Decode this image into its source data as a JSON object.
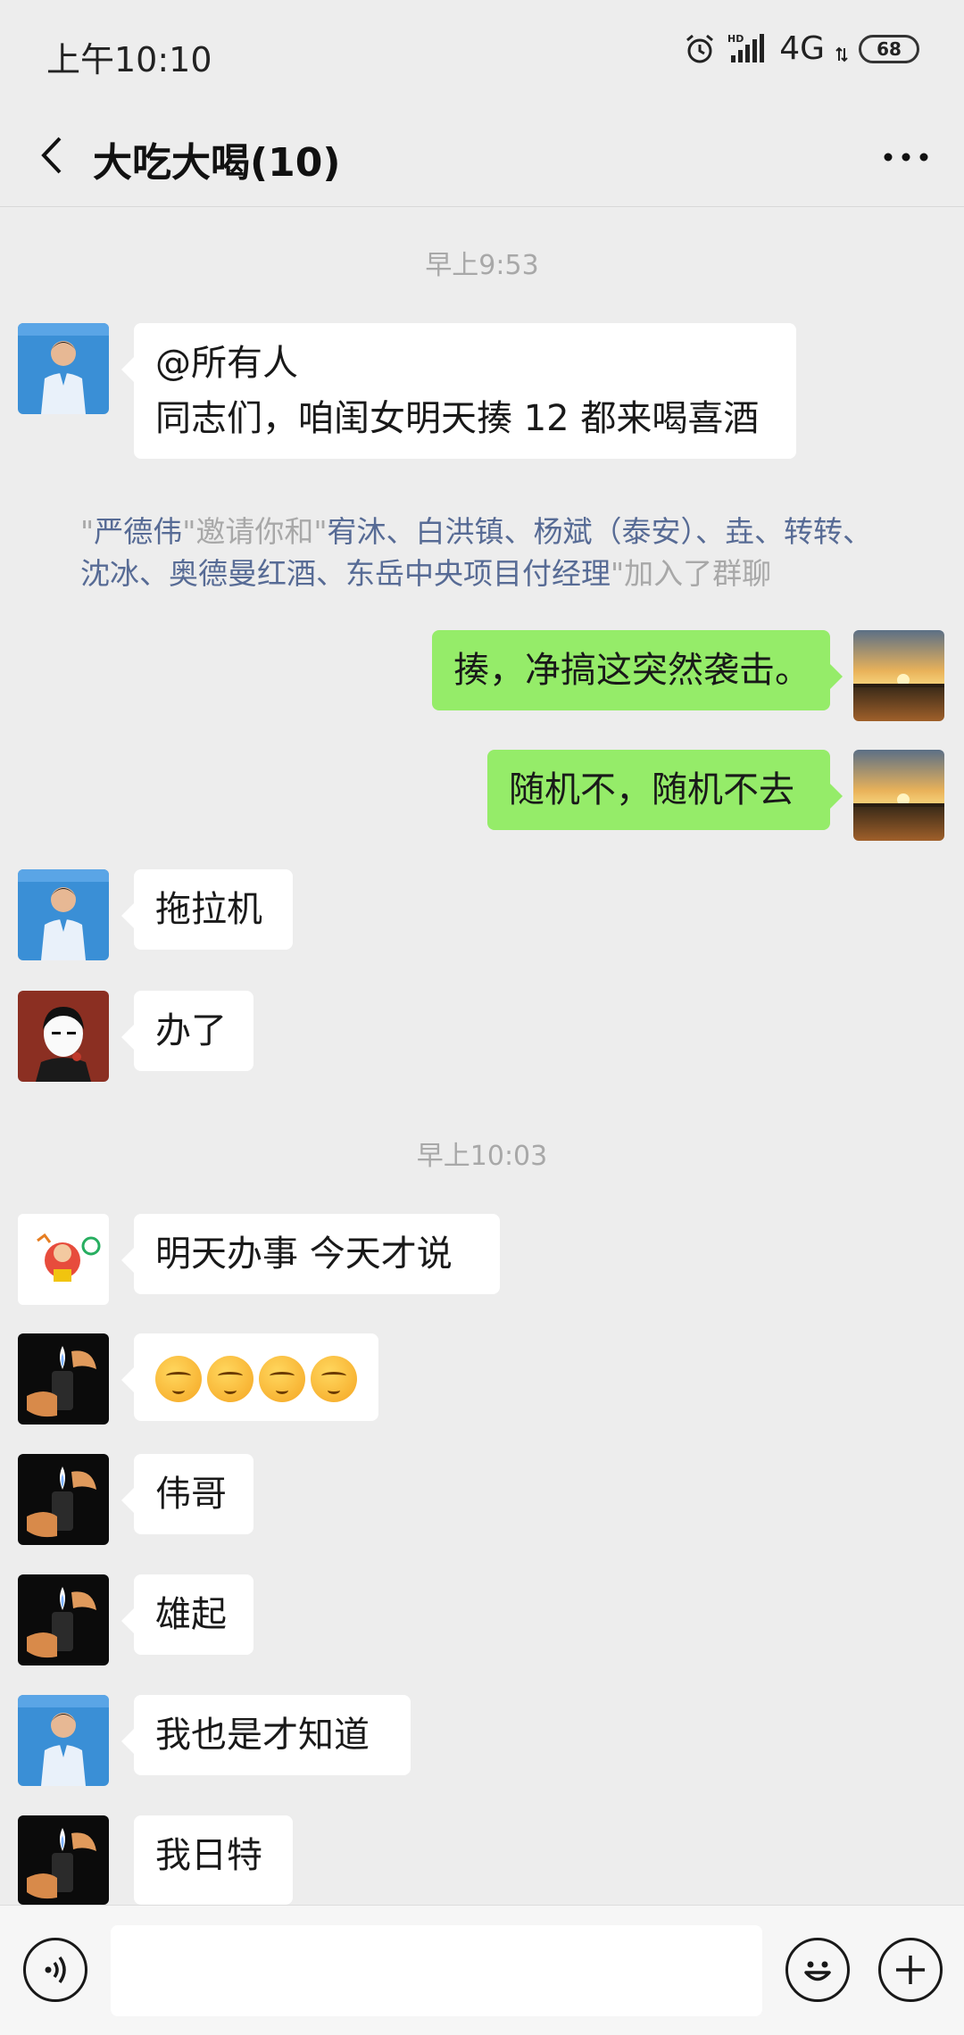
{
  "status_bar": {
    "time": "上午10:10",
    "network": "4G",
    "battery": "68",
    "icons": [
      "alarm-icon",
      "hd-signal-icon",
      "4g-icon",
      "battery-icon"
    ]
  },
  "header": {
    "title": "大吃大喝(10)",
    "back_icon": "chevron-left-icon",
    "more_icon": "more-dots-icon"
  },
  "messages": {
    "ts1": "早上9:53",
    "m1": {
      "line1": "@所有人",
      "line2": "同志们，咱闺女明天揍 12 都来喝喜酒"
    },
    "sys": {
      "q1": "\"",
      "inviter": "严德伟",
      "mid": "\"邀请你和\"",
      "invitees_line1": "宥沐、白洪镇、杨斌（泰安）、垚、转转、",
      "invitees_line2": "沈冰、奥德曼红酒、东岳中央项目付经理",
      "tail": "\"加入了群聊"
    },
    "m2": "揍，净搞这突然袭击。",
    "m3": "随机不，随机不去",
    "m4": "拖拉机",
    "m5": "办了",
    "ts2": "早上10:03",
    "m6": "明天办事 今天才说",
    "m7_emoji": "emoji-face-x4",
    "m8": "伟哥",
    "m9": "雄起",
    "m10": "我也是才知道",
    "m11": "我日特"
  },
  "input_bar": {
    "voice_icon": "voice-icon",
    "emoji_icon": "emoji-icon",
    "plus_icon": "plus-icon",
    "input_value": ""
  },
  "colors": {
    "background": "#ededed",
    "bubble_self": "#95ec69",
    "bubble_other": "#ffffff",
    "name_link": "#576b95",
    "system_text": "#a8a8a8"
  }
}
